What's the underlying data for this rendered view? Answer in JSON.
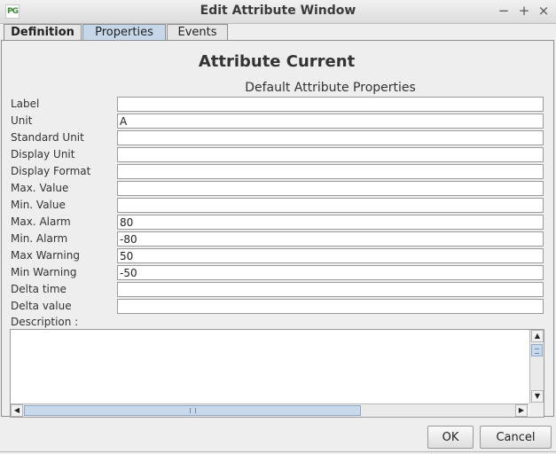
{
  "window": {
    "title": "Edit Attribute Window",
    "app_icon_text": "PG",
    "minimize_glyph": "−",
    "maximize_glyph": "+",
    "close_glyph": "×"
  },
  "tabs": [
    {
      "label": "Definition",
      "active": false
    },
    {
      "label": "Properties",
      "active": true
    },
    {
      "label": "Events",
      "active": false
    }
  ],
  "panel": {
    "heading": "Attribute Current",
    "subheading": "Default Attribute Properties",
    "fields": [
      {
        "label": "Label",
        "value": ""
      },
      {
        "label": "Unit",
        "value": "A"
      },
      {
        "label": "Standard Unit",
        "value": ""
      },
      {
        "label": "Display Unit",
        "value": ""
      },
      {
        "label": "Display Format",
        "value": ""
      },
      {
        "label": "Max. Value",
        "value": ""
      },
      {
        "label": "Min. Value",
        "value": ""
      },
      {
        "label": "Max. Alarm",
        "value": "80"
      },
      {
        "label": "Min. Alarm",
        "value": "-80"
      },
      {
        "label": "Max Warning",
        "value": "50"
      },
      {
        "label": "Min Warning",
        "value": "-50"
      },
      {
        "label": "Delta time",
        "value": ""
      },
      {
        "label": "Delta value",
        "value": ""
      }
    ],
    "description_label": "Description :",
    "description_value": ""
  },
  "buttons": {
    "ok": "OK",
    "cancel": "Cancel"
  },
  "icons": {
    "scroll_up": "▲",
    "scroll_down": "▼",
    "scroll_left": "◀",
    "scroll_right": "▶"
  }
}
